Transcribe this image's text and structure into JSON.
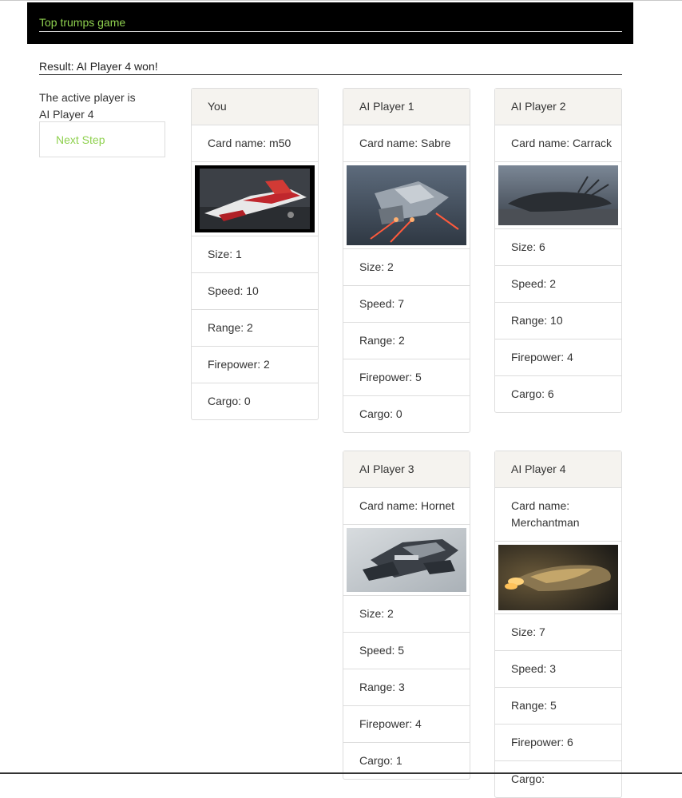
{
  "header": {
    "title": "Top trumps game"
  },
  "result": "Result: AI Player 4 won!",
  "active": {
    "line1": "The active player is",
    "line2": "AI Player 4"
  },
  "next_step_label": "Next Step",
  "cards": {
    "you": {
      "player": "You",
      "name": "Card name: m50",
      "size": "Size: 1",
      "speed": "Speed: 10",
      "range": "Range: 2",
      "firepower": "Firepower: 2",
      "cargo": "Cargo: 0"
    },
    "ai1": {
      "player": "AI Player 1",
      "name": "Card name: Sabre",
      "size": "Size: 2",
      "speed": "Speed: 7",
      "range": "Range: 2",
      "firepower": "Firepower: 5",
      "cargo": "Cargo: 0"
    },
    "ai2": {
      "player": "AI Player 2",
      "name": "Card name: Carrack",
      "size": "Size: 6",
      "speed": "Speed: 2",
      "range": "Range: 10",
      "firepower": "Firepower: 4",
      "cargo": "Cargo: 6"
    },
    "ai3": {
      "player": "AI Player 3",
      "name": "Card name: Hornet",
      "size": "Size: 2",
      "speed": "Speed: 5",
      "range": "Range: 3",
      "firepower": "Firepower: 4",
      "cargo": "Cargo: 1"
    },
    "ai4": {
      "player": "AI Player 4",
      "name": "Card name: Merchantman",
      "size": "Size: 7",
      "speed": "Speed: 3",
      "range": "Range: 5",
      "firepower": "Firepower: 6",
      "cargo": "Cargo: "
    }
  },
  "colors": {
    "accent": "#8fd14f",
    "header_bg": "#000000",
    "card_head_bg": "#f5f3ef"
  }
}
